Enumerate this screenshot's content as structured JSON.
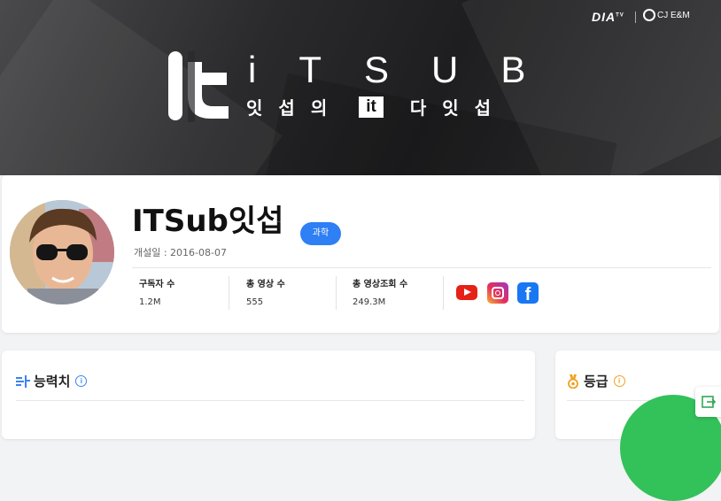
{
  "banner": {
    "brand_dia": "DIA",
    "brand_dia_tm": "TV",
    "brand_cj": "CJ E&M",
    "logo_title": "iTSUB",
    "logo_sub_1": "잇",
    "logo_sub_2": "섭",
    "logo_sub_3": "의",
    "logo_sub_box": "it",
    "logo_sub_4": "다",
    "logo_sub_5": "잇",
    "logo_sub_6": "섭"
  },
  "channel": {
    "name": "ITSub잇섭",
    "category_tag": "과학",
    "opened": "개설일 : 2016-08-07",
    "stats": [
      {
        "label": "구독자 수",
        "value": "1.2M"
      },
      {
        "label": "총 영상 수",
        "value": "555"
      },
      {
        "label": "총 영상조회 수",
        "value": "249.3M"
      }
    ],
    "social": [
      "youtube-icon",
      "instagram-icon",
      "facebook-icon"
    ]
  },
  "sections": {
    "ability": {
      "title": "능력치",
      "icon": "ability-icon"
    },
    "grade": {
      "title": "등급",
      "icon": "medal-icon"
    }
  },
  "colors": {
    "accent": "#2f7ff5",
    "info_blue": "#3b82f6",
    "info_orange": "#f0a020",
    "grade_green": "#33c15a"
  }
}
